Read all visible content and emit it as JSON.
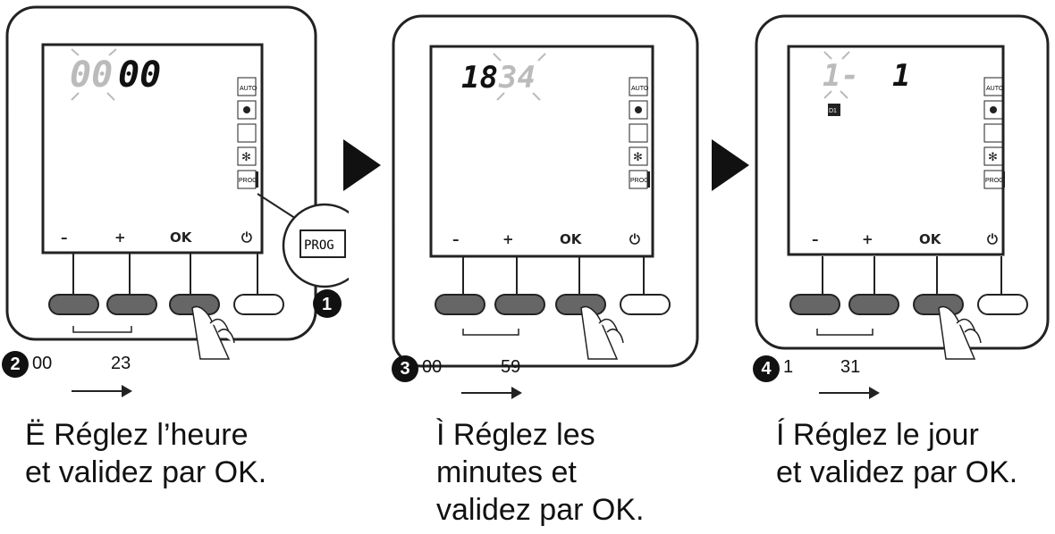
{
  "panels": [
    {
      "lcd_left": "00",
      "lcd_right": "00",
      "step": "2",
      "range_from": "00",
      "range_to": "23",
      "caption": "Ë Réglez l’heure\net validez par OK."
    },
    {
      "lcd_left": "18",
      "lcd_right": "34",
      "step": "3",
      "range_from": "00",
      "range_to": "59",
      "caption": "Ì  Réglez les\nminutes et\nvalidez par OK."
    },
    {
      "lcd_left": "1-",
      "lcd_right": "1",
      "step": "4",
      "range_from": "1",
      "range_to": "31",
      "caption": "Í Réglez le jour\net validez par OK."
    }
  ],
  "buttons": {
    "minus": "–",
    "plus": "+",
    "ok": "OK",
    "power": "⏻"
  },
  "mode_icons": {
    "auto": "AUTO",
    "prog": "PROG"
  },
  "zoom": {
    "label": "PROG",
    "step": "1"
  },
  "day_icon": "D1"
}
